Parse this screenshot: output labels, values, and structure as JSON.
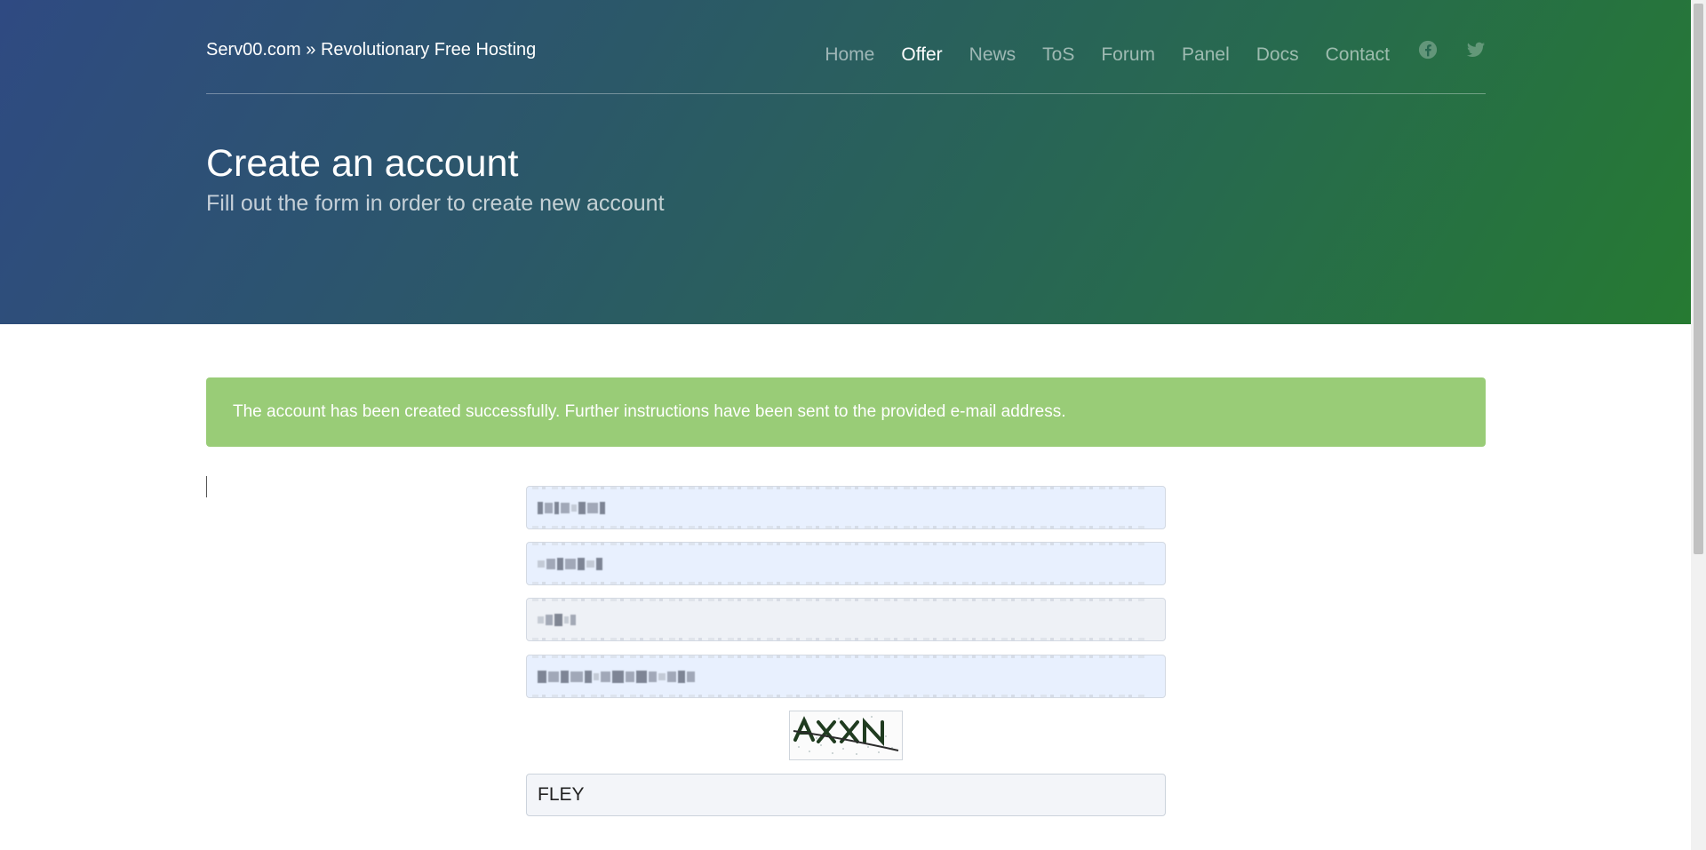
{
  "header": {
    "brand": "Serv00.com » Revolutionary Free Hosting",
    "nav": [
      {
        "label": "Home",
        "active": false
      },
      {
        "label": "Offer",
        "active": true
      },
      {
        "label": "News",
        "active": false
      },
      {
        "label": "ToS",
        "active": false
      },
      {
        "label": "Forum",
        "active": false
      },
      {
        "label": "Panel",
        "active": false
      },
      {
        "label": "Docs",
        "active": false
      },
      {
        "label": "Contact",
        "active": false
      }
    ],
    "social": [
      "facebook-icon",
      "twitter-icon"
    ],
    "title": "Create an account",
    "subtitle": "Fill out the form in order to create new account"
  },
  "alert": {
    "message": "The account has been created successfully. Further instructions have been sent to the provided e-mail address.",
    "color": "#99cc77"
  },
  "form": {
    "captcha_value": "FLEY"
  },
  "colors": {
    "gradient_start": "#2f4a82",
    "gradient_end": "#267a32",
    "autofill_bg": "#e8f0fe"
  }
}
